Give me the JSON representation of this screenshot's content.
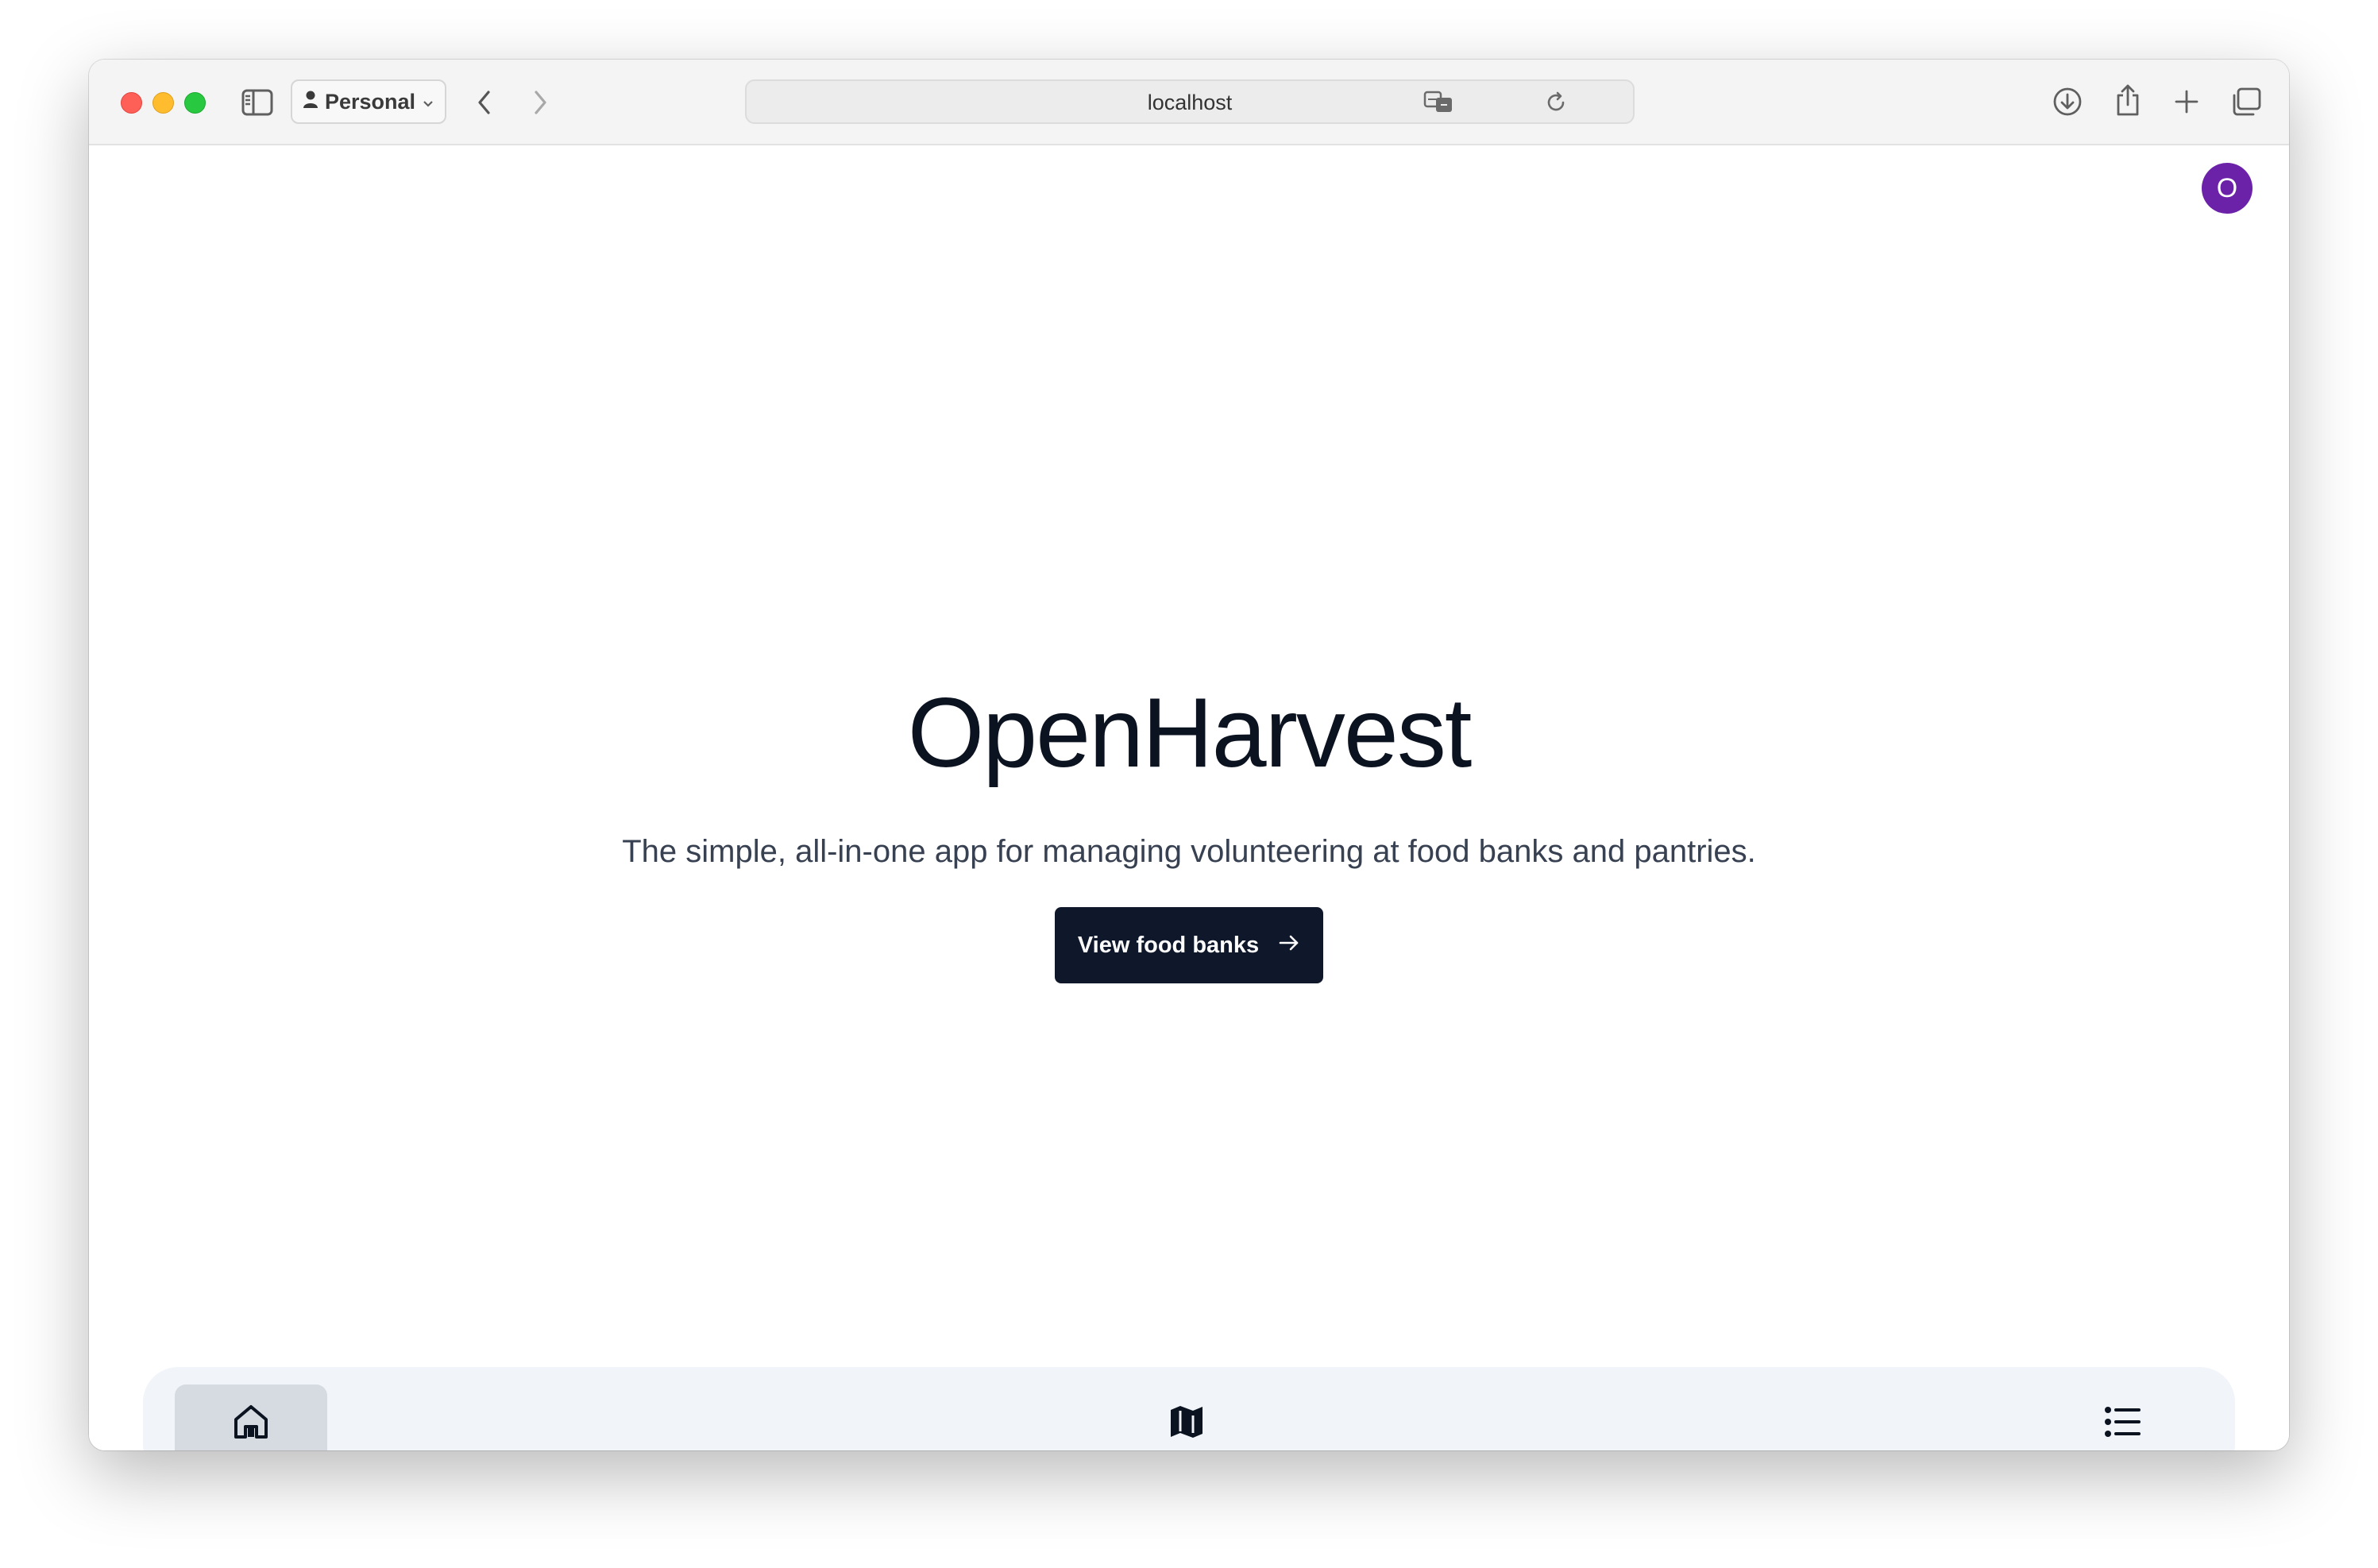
{
  "browser": {
    "profile_label": "Personal",
    "url": "localhost"
  },
  "app": {
    "avatar_initial": "O",
    "avatar_color": "#6b21a8",
    "title": "OpenHarvest",
    "subtitle": "The simple, all-in-one app for managing volunteering at food banks and pantries.",
    "cta_label": "View food banks",
    "cta_icon": "arrow-right-icon",
    "accent_color": "#0f172a"
  },
  "bottom_nav": {
    "items": [
      {
        "icon": "home-icon",
        "active": true
      },
      {
        "icon": "map-icon",
        "active": false
      },
      {
        "icon": "list-icon",
        "active": false
      }
    ]
  }
}
